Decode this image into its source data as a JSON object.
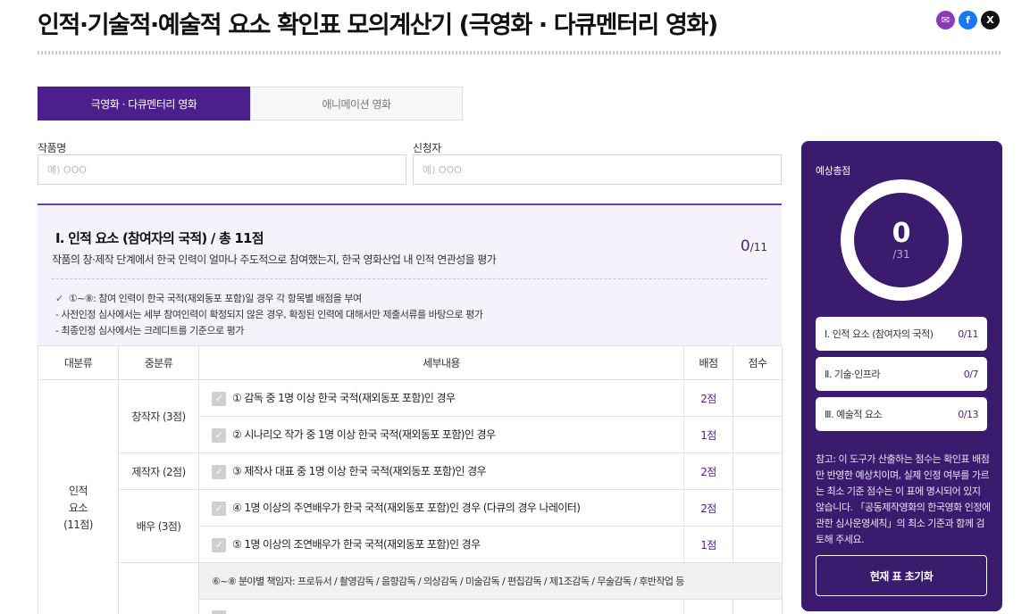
{
  "page": {
    "title": "인적·기술적·예술적 요소 확인표 모의계산기 (극영화 · 다큐멘터리 영화)"
  },
  "share": {
    "icons": [
      "mail-icon",
      "facebook-icon",
      "x-icon"
    ],
    "glyphs": [
      "✉",
      "f",
      "X"
    ]
  },
  "tabs": [
    {
      "label": "극영화 · 다큐멘터리 영화",
      "active": true
    },
    {
      "label": "애니메이션 영화",
      "active": false
    }
  ],
  "form": {
    "work_label": "작품명",
    "work_placeholder": "예) OOO",
    "applicant_label": "신청자",
    "applicant_placeholder": "예) OOO"
  },
  "section1": {
    "title": "Ⅰ. 인적 요소 (참여자의 국적) / 총 11점",
    "description": "작품의 창·제작 단계에서 한국 인력이 얼마나 주도적으로 참여했는지, 한국 영화산업 내 인적 연관성을 평가",
    "score": "0",
    "score_max": "/11",
    "check_mark": "✓",
    "notes": [
      "①~⑧: 참여 인력이 한국 국적(재외동포 포함)일 경우 각 항목별 배점을 부여",
      "- 사전인정 심사에서는 세부 참여인력이 확정되지 않은 경우, 확정된 인력에 대해서만 제출서류를 바탕으로 평가",
      "- 최종인정 심사에서는 크레디트를 기준으로 평가"
    ]
  },
  "table": {
    "headers": [
      "대분류",
      "중분류",
      "세부내용",
      "배점",
      "점수"
    ],
    "major": [
      "인적",
      "요소",
      "(11점)"
    ],
    "groups": [
      "창작자 (3점)",
      "제작자 (2점)",
      "배우 (3점)"
    ],
    "checkbox_glyph": "✓",
    "rows": [
      {
        "detail": "① 감독 중 1명 이상 한국 국적(재외동포 포함)인 경우",
        "points": "2점"
      },
      {
        "detail": "② 시나리오 작가 중 1명 이상 한국 국적(재외동포 포함)인 경우",
        "points": "1점"
      },
      {
        "detail": "③ 제작사 대표 중 1명 이상 한국 국적(재외동포 포함)인 경우",
        "points": "2점"
      },
      {
        "detail": "④ 1명 이상의 주연배우가 한국 국적(재외동포 포함)인 경우 (다큐의 경우 나레이터)",
        "points": "2점"
      },
      {
        "detail": "⑤ 1명 이상의 조연배우가 한국 국적(재외동포 포함)인 경우",
        "points": "1점"
      }
    ],
    "sub_note": "⑥~⑧ 분야별 책임자: 프로듀서 / 촬영감독 / 음향감독 / 의상감독 / 미술감독 / 편집감독 / 제1조감독 / 무술감독 / 후반작업 등"
  },
  "sidebar": {
    "label": "예상총점",
    "total": "0",
    "total_max": "/31",
    "items": [
      {
        "name": "Ⅰ. 인적 요소 (참여자의 국적)",
        "score": "0/11"
      },
      {
        "name": "Ⅱ. 기술·인프라",
        "score": "0/7"
      },
      {
        "name": "Ⅲ. 예술적 요소",
        "score": "0/13"
      }
    ],
    "note": "참고: 이 도구가 산출하는 점수는 확인표 배점만 반영한 예상치이며, 실제 인정 여부를 가르는 최소 기준 점수는 이 표에 명시되어 있지 않습니다. 「공동제작영화의 한국영화 인정에 관한 심사운영세칙」의 최소 기준과 함께 검토해 주세요.",
    "reset_label": "현재 표 초기화"
  },
  "colors": {
    "accent": "#4d1f8c",
    "sidebar_bg": "#3b1b6e",
    "section_bg": "#f6f2fb"
  }
}
